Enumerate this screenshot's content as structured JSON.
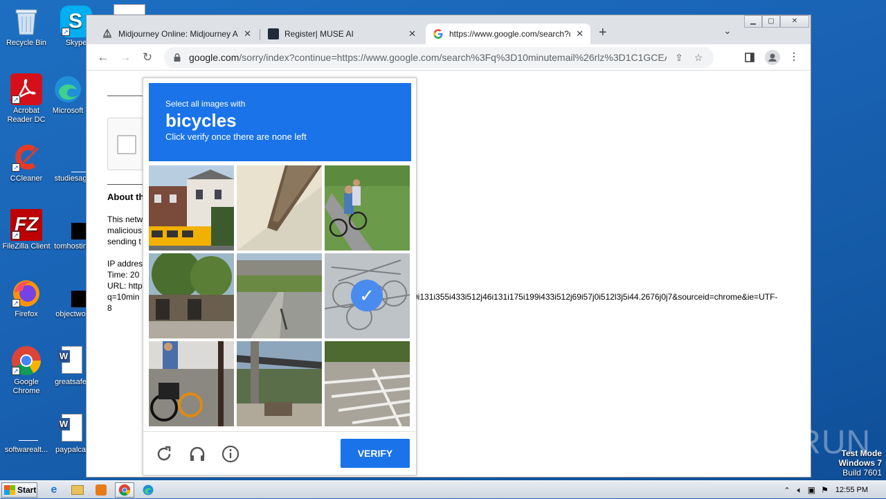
{
  "desktop": {
    "icons": [
      {
        "label": "Recycle Bin",
        "name": "recycle-bin-icon"
      },
      {
        "label": "Skype",
        "name": "skype-icon"
      },
      {
        "label": "Acrobat Reader DC",
        "name": "acrobat-reader-icon"
      },
      {
        "label": "Microsoft",
        "name": "microsoft-edge-icon"
      },
      {
        "label": "CCleaner",
        "name": "ccleaner-icon"
      },
      {
        "label": "studiesag",
        "name": "file-icon"
      },
      {
        "label": "FileZilla Client",
        "name": "filezilla-icon"
      },
      {
        "label": "tomhostin",
        "name": "file-icon"
      },
      {
        "label": "Firefox",
        "name": "firefox-icon"
      },
      {
        "label": "objectwo",
        "name": "file-icon"
      },
      {
        "label": "Google Chrome",
        "name": "chrome-icon"
      },
      {
        "label": "greatsafe",
        "name": "word-doc-icon"
      },
      {
        "label": "softwarealt...",
        "name": "file-icon"
      },
      {
        "label": "paypalca",
        "name": "word-doc-icon"
      }
    ]
  },
  "browser": {
    "tabs": [
      {
        "title": "Midjourney Online: Midjourney Ai On",
        "favicon": "sailboat-icon"
      },
      {
        "title": "Register| MUSE AI",
        "favicon": "muse-icon"
      },
      {
        "title": "https://www.google.com/search?q=",
        "favicon": "google-icon"
      }
    ],
    "new_tab": "+",
    "tab_menu": "⌄",
    "url_host": "google.com",
    "url_rest": "/sorry/index?continue=https://www.google.com/search%3Fq%3D10minutemail%26rlz%3D1C1GCEA_..."
  },
  "page": {
    "about_heading": "About th",
    "line1": "This netw",
    "line2": "malicious",
    "line3": "sending t",
    "ip": "IP addres",
    "time": "Time: 20",
    "url_label": "URL: http",
    "url_cont": "q=10min",
    "url_tail": "0i131i355i433i512j46i131i175i199i433i512j69i57j0i512l3j5i44.2676j0j7&sourceid=chrome&ie=UTF-",
    "url_end": "8"
  },
  "captcha": {
    "subtitle": "Select all images with",
    "target": "bicycles",
    "instruction": "Click verify once there are none left",
    "tiles": [
      {
        "scene": "house-with-school-bus",
        "selected": false
      },
      {
        "scene": "ceiling-beam",
        "selected": false
      },
      {
        "scene": "people-with-bicycles",
        "selected": false
      },
      {
        "scene": "trees-and-storefront",
        "selected": false
      },
      {
        "scene": "road-under-bridge",
        "selected": false
      },
      {
        "scene": "parked-bicycles",
        "selected": true
      },
      {
        "scene": "scooter-and-bike",
        "selected": false
      },
      {
        "scene": "carport",
        "selected": false
      },
      {
        "scene": "crosswalk",
        "selected": false
      }
    ],
    "verify_label": "VERIFY"
  },
  "watermark": "ANY RUN",
  "testmode": {
    "line1": "Test Mode",
    "line2": "Windows 7",
    "line3": "Build 7601"
  },
  "taskbar": {
    "start_label": "Start",
    "clock": "12:55 PM"
  }
}
